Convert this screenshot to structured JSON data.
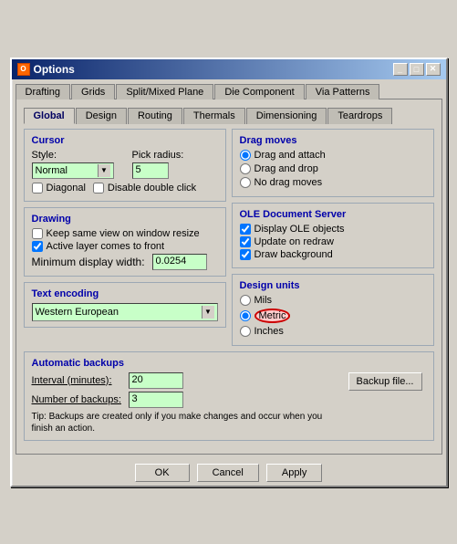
{
  "window": {
    "title": "Options",
    "icon": "O"
  },
  "title_buttons": {
    "minimize": "_",
    "maximize": "□",
    "close": "✕"
  },
  "tabs_row1": {
    "items": [
      "Drafting",
      "Grids",
      "Split/Mixed Plane",
      "Die Component",
      "Via Patterns"
    ]
  },
  "tabs_row2": {
    "items": [
      "Global",
      "Design",
      "Routing",
      "Thermals",
      "Dimensioning",
      "Teardrops"
    ],
    "active": "Global"
  },
  "cursor_section": {
    "label": "Cursor",
    "style_label": "Style:",
    "style_value": "Normal",
    "pick_radius_label": "Pick radius:",
    "pick_radius_value": "5",
    "diagonal_label": "Diagonal",
    "disable_dblclick_label": "Disable double click"
  },
  "drag_moves_section": {
    "label": "Drag moves",
    "options": [
      {
        "label": "Drag and attach",
        "checked": true
      },
      {
        "label": "Drag and drop",
        "checked": false
      },
      {
        "label": "No drag moves",
        "checked": false
      }
    ]
  },
  "drawing_section": {
    "label": "Drawing",
    "options": [
      {
        "label": "Keep same view on window resize",
        "checked": false
      },
      {
        "label": "Active layer comes to front",
        "checked": true
      }
    ],
    "min_display_label": "Minimum display width:",
    "min_display_value": "0.0254"
  },
  "ole_section": {
    "label": "OLE Document Server",
    "options": [
      {
        "label": "Display OLE objects",
        "checked": true
      },
      {
        "label": "Update on redraw",
        "checked": true
      },
      {
        "label": "Draw background",
        "checked": true
      }
    ]
  },
  "text_encoding_section": {
    "label": "Text encoding",
    "value": "Western European"
  },
  "design_units_section": {
    "label": "Design units",
    "options": [
      {
        "label": "Mils",
        "checked": false
      },
      {
        "label": "Metric",
        "checked": true,
        "highlight": true
      },
      {
        "label": "Inches",
        "checked": false
      }
    ]
  },
  "backups_section": {
    "label": "Automatic backups",
    "interval_label": "Interval (minutes):",
    "interval_value": "20",
    "num_backups_label": "Number of backups:",
    "num_backups_value": "3",
    "tip_text": "Tip: Backups are created only if you make changes and occur when you finish an action.",
    "backup_btn_label": "Backup file..."
  },
  "bottom_buttons": {
    "ok": "OK",
    "cancel": "Cancel",
    "apply": "Apply"
  }
}
